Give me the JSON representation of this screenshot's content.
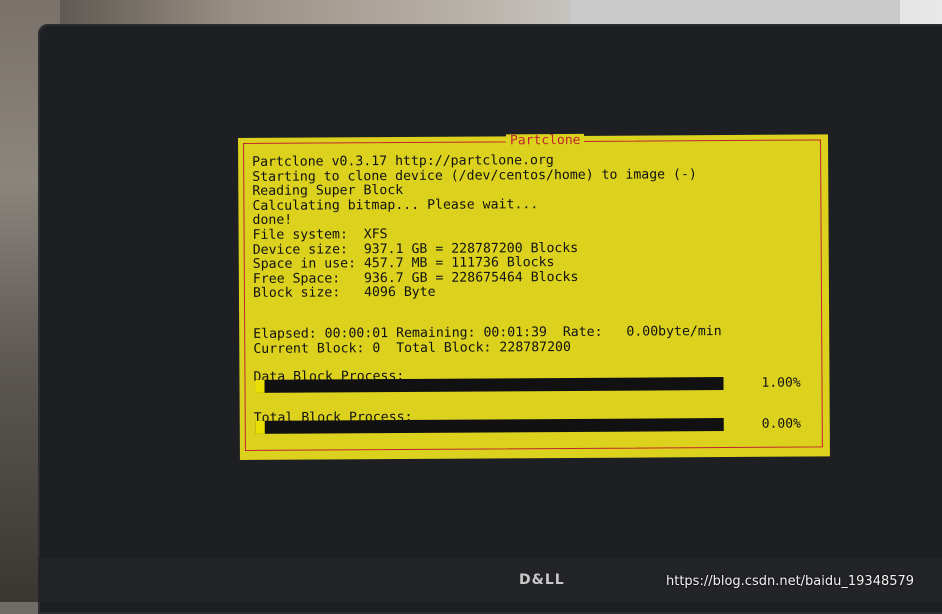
{
  "watermark": "https://blog.csdn.net/baidu_19348579",
  "monitor_logo": "D&LL",
  "terminal": {
    "title": "Partclone",
    "lines": [
      "Partclone v0.3.17 http://partclone.org",
      "Starting to clone device (/dev/centos/home) to image (-)",
      "Reading Super Block",
      "Calculating bitmap... Please wait...",
      "done!",
      "File system:  XFS",
      "Device size:  937.1 GB = 228787200 Blocks",
      "Space in use: 457.7 MB = 111736 Blocks",
      "Free Space:   936.7 GB = 228675464 Blocks",
      "Block size:   4096 Byte"
    ],
    "elapsed_line": "Elapsed: 00:00:01 Remaining: 00:01:39  Rate:   0.00byte/min",
    "block_line": "Current Block: 0  Total Block: 228787200",
    "data_process": {
      "label": "Data Block Process:",
      "percent_text": "1.00%",
      "fraction": 0.01
    },
    "total_process": {
      "label": "Total Block Process:",
      "percent_text": "0.00%",
      "fraction": 0.0
    }
  },
  "colors": {
    "terminal_bg": "#dcd21e",
    "frame_red": "#c0252c",
    "bar_black": "#111111",
    "bar_fill": "#e8e000"
  }
}
